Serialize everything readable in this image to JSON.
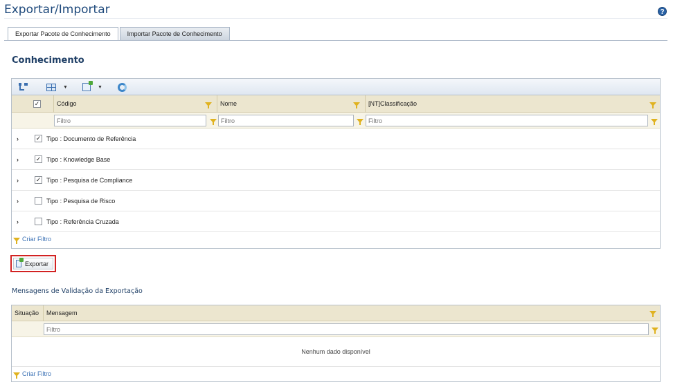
{
  "page": {
    "title": "Exportar/Importar",
    "help_icon": "question-icon"
  },
  "tabs": [
    {
      "label": "Exportar Pacote de Conhecimento",
      "active": true
    },
    {
      "label": "Importar Pacote de Conhecimento",
      "active": false
    }
  ],
  "knowledge_section": {
    "title": "Conhecimento",
    "toolbar_icons": [
      "tree-structure-icon",
      "expand-columns-icon",
      "export-document-icon",
      "refresh-icon"
    ],
    "columns": [
      "Código",
      "Nome",
      "[NT]Classificação"
    ],
    "filter_placeholder": "Filtro",
    "rows": [
      {
        "label": "Tipo : Documento de Referência",
        "checked": true
      },
      {
        "label": "Tipo : Knowledge Base",
        "checked": true
      },
      {
        "label": "Tipo : Pesquisa de Compliance",
        "checked": true
      },
      {
        "label": "Tipo : Pesquisa de Risco",
        "checked": false
      },
      {
        "label": "Tipo : Referência Cruzada",
        "checked": false
      }
    ],
    "create_filter": "Criar Filtro"
  },
  "export_button": {
    "label": "Exportar"
  },
  "validation_section": {
    "title": "Mensagens de Validação da Exportação",
    "columns": [
      "Situação",
      "Mensagem"
    ],
    "filter_placeholder": "Filtro",
    "empty_message": "Nenhum dado disponível",
    "create_filter": "Criar Filtro"
  },
  "colors": {
    "title_blue": "#1f4a7c",
    "header_beige": "#ece6cf",
    "filter_funnel": "#e0b21f",
    "link_blue": "#3a70b4",
    "highlight_red": "#d22222"
  }
}
